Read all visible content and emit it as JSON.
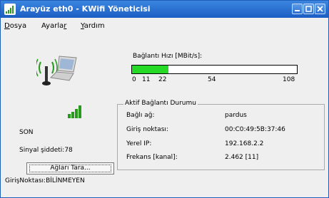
{
  "window": {
    "title": "Arayüz eth0 - KWifi Yöneticisi"
  },
  "menu": {
    "items": [
      {
        "label": "Dosya"
      },
      {
        "label": "Ayarlar"
      },
      {
        "label": "Yardım"
      }
    ]
  },
  "speed": {
    "label": "Bağlantı Hızı [MBit/s]:",
    "value_mbits": 22,
    "max_mbits": 108,
    "ticks": [
      "0",
      "11",
      "22",
      "54",
      "108"
    ]
  },
  "status": {
    "state": "SON",
    "signal_text": "Sinyal şiddeti:78",
    "access_point_text": "GirişNoktası:BİLİNMEYEN",
    "scan_button_label": "Ağları Tara..."
  },
  "connection": {
    "group_title": "Aktif Bağlantı Durumu",
    "rows": [
      {
        "label": "Bağlı ağ:",
        "value": "pardus"
      },
      {
        "label": "Giriş noktası:",
        "value": "00:C0:49:5B:37:46"
      },
      {
        "label": "Yerel IP:",
        "value": "192.168.2.2"
      },
      {
        "label": "Frekans [kanal]:",
        "value": "2.462 [11]"
      }
    ]
  },
  "icons": {
    "app": "signal-bars-icon",
    "status": "wifi-laptop-icon",
    "signal": "signal-strength-icon"
  },
  "colors": {
    "titlebar": "#1b5dc3",
    "progress_fill": "#27d927",
    "signal_bars": "#2a9a1e"
  }
}
